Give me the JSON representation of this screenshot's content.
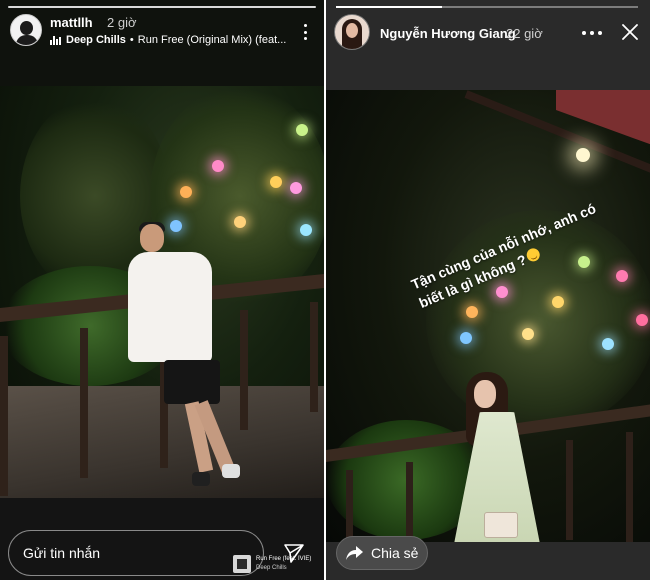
{
  "left_story": {
    "username": "mattllh",
    "time": "2 giờ",
    "music": {
      "artist": "Deep Chills",
      "separator": "•",
      "track": "Run Free (Original Mix) (feat..."
    },
    "message_placeholder": "Gửi tin nhắn",
    "mini_player": {
      "track": "Run Free (feat. IVIE)",
      "artist": "Deep Chills"
    }
  },
  "right_story": {
    "username": "Nguyễn Hương Giang",
    "time": "22 giờ",
    "progress": 0.35,
    "caption": "Tận cùng của nỗi nhớ, anh có biết là gì không ?",
    "share_label": "Chia sẻ"
  },
  "icons": {
    "left_more": "more-vertical-icon",
    "right_more": "more-horizontal-icon",
    "close": "close-icon",
    "send": "send-icon",
    "share": "share-arrow-icon",
    "music": "music-bars-icon"
  },
  "colors": {
    "story_background": "#1a1a1a",
    "text": "#ffffff"
  }
}
